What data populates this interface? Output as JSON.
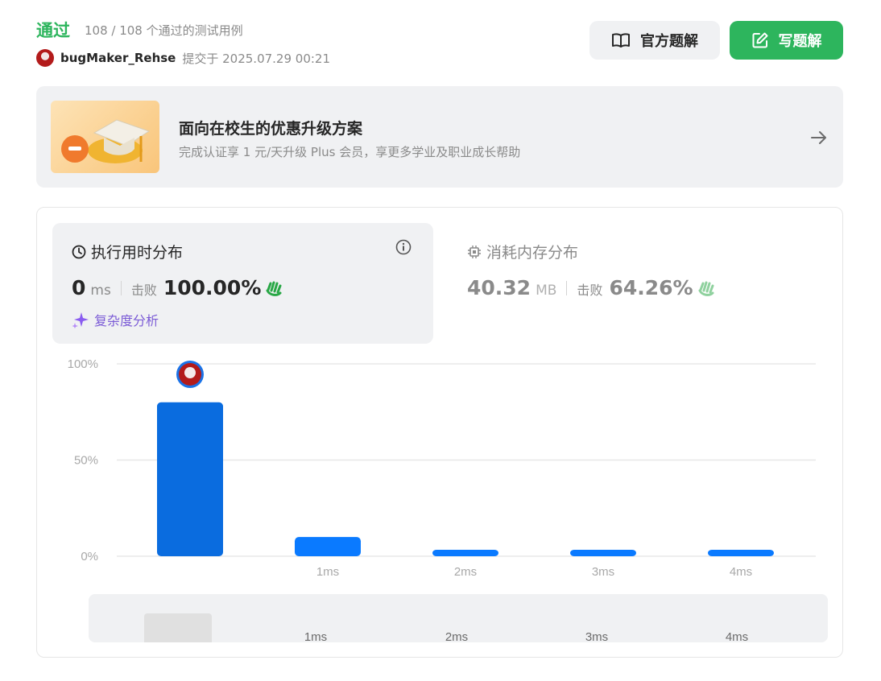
{
  "header": {
    "status": "通过",
    "cases": "108 / 108 个通过的测试用例",
    "username": "bugMaker_Rehse",
    "submitted": "提交于 2025.07.29 00:21",
    "official_solution_label": "官方题解",
    "write_solution_label": "写题解",
    "accent_green": "#2db55d"
  },
  "promo": {
    "title": "面向在校生的优惠升级方案",
    "subtitle": "完成认证享 1 元/天升级 Plus 会员，享更多学业及职业成长帮助"
  },
  "runtime": {
    "title": "执行用时分布",
    "value": "0",
    "unit": "ms",
    "beat_label": "击败",
    "beat_value": "100.00%",
    "complexity_label": "复杂度分析"
  },
  "memory": {
    "title": "消耗内存分布",
    "value": "40.32",
    "unit": "MB",
    "beat_label": "击败",
    "beat_value": "64.26%"
  },
  "chart_data": {
    "type": "bar",
    "categories": [
      "",
      "1ms",
      "2ms",
      "3ms",
      "4ms"
    ],
    "values": [
      80,
      10,
      2,
      2,
      2
    ],
    "yticks": [
      "100%",
      "50%",
      "0%"
    ],
    "ylim": [
      0,
      100
    ],
    "highlight_index": 0,
    "colors": {
      "highlight": "#0a6cdf",
      "bar": "#0a7aff",
      "grid": "#e8e8e8",
      "tick": "#a8a8a8"
    },
    "grid": true
  },
  "mini_chart": {
    "values": [
      80,
      10,
      2,
      2,
      2
    ],
    "labels": [
      "",
      "1ms",
      "2ms",
      "3ms",
      "4ms"
    ]
  }
}
